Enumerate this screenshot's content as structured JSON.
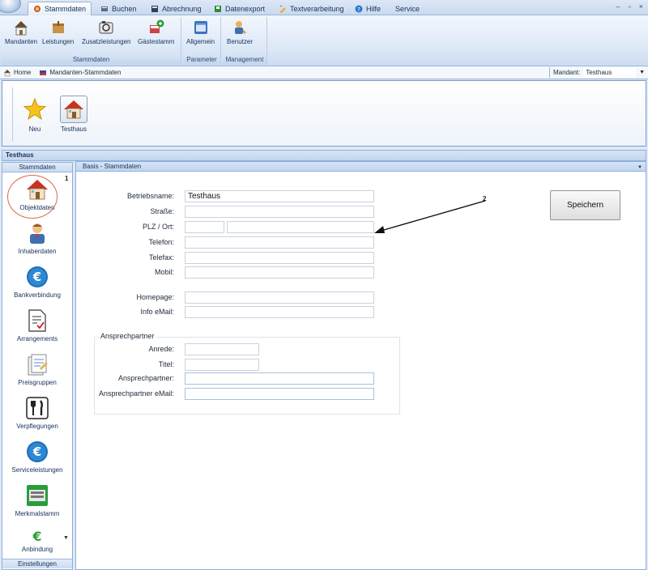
{
  "tabs": [
    {
      "label": "Stammdaten",
      "icon": "stammdaten-icon",
      "active": true
    },
    {
      "label": "Buchen",
      "icon": "buchen-icon"
    },
    {
      "label": "Abrechnung",
      "icon": "abrechnung-icon"
    },
    {
      "label": "Datenexport",
      "icon": "datenexport-icon"
    },
    {
      "label": "Textverarbeitung",
      "icon": "textverarbeitung-icon"
    },
    {
      "label": "Hilfe",
      "icon": "help-icon"
    },
    {
      "label": "Service",
      "icon": ""
    }
  ],
  "window_controls": [
    "–",
    "▫",
    "×"
  ],
  "ribbon": {
    "groups": [
      {
        "label": "Stammdaten",
        "buttons": [
          "Mandanten",
          "Leistungen",
          "Zusatzleistungen",
          "Gästestamm"
        ]
      },
      {
        "label": "Parameter",
        "buttons": [
          "Allgemein"
        ]
      },
      {
        "label": "Management",
        "buttons": [
          "Benutzer"
        ]
      }
    ]
  },
  "breadcrumb": [
    {
      "label": "Home",
      "icon": "home-icon"
    },
    {
      "label": "Mandanten-Stammdaten",
      "icon": "flag-icon"
    }
  ],
  "mandant": {
    "label": "Mandant:",
    "value": "Testhaus"
  },
  "big_buttons": [
    {
      "label": "Neu",
      "icon": "star-icon"
    },
    {
      "label": "Testhaus",
      "icon": "house-icon"
    }
  ],
  "section_title": "Testhaus",
  "left_nav": {
    "header": "Stammdaten",
    "items": [
      "Objektdaten",
      "Inhaberdaten",
      "Bankverbindung",
      "Arrangements",
      "Preisgruppen",
      "Verpflegungen",
      "Serviceleistungen",
      "Merkmalstamm",
      "Anbindung"
    ],
    "footer": "Einstellungen",
    "annotation": "1"
  },
  "main": {
    "header": "Basis - Stammdaten",
    "fields": [
      {
        "label": "Betriebsname:",
        "value": "Testhaus"
      },
      {
        "label": "Straße:",
        "value": ""
      },
      {
        "label": "PLZ / Ort:",
        "value": "",
        "value2": ""
      },
      {
        "label": "Telefon:",
        "value": ""
      },
      {
        "label": "Telefax:",
        "value": ""
      },
      {
        "label": "Mobil:",
        "value": ""
      },
      {
        "label": "Homepage:",
        "value": ""
      },
      {
        "label": "Info eMail:",
        "value": ""
      }
    ],
    "contact": {
      "legend": "Ansprechpartner",
      "fields": [
        {
          "label": "Anrede:",
          "value": ""
        },
        {
          "label": "Titel:",
          "value": ""
        },
        {
          "label": "Ansprechpartner:",
          "value": ""
        },
        {
          "label": "Ansprechpartner eMail:",
          "value": ""
        }
      ]
    },
    "save_label": "Speichern",
    "annotation": "2"
  },
  "colors": {
    "accent": "#9ab4d8",
    "highlight_circle": "#d96a4a",
    "panel": "#dfe8f5"
  }
}
